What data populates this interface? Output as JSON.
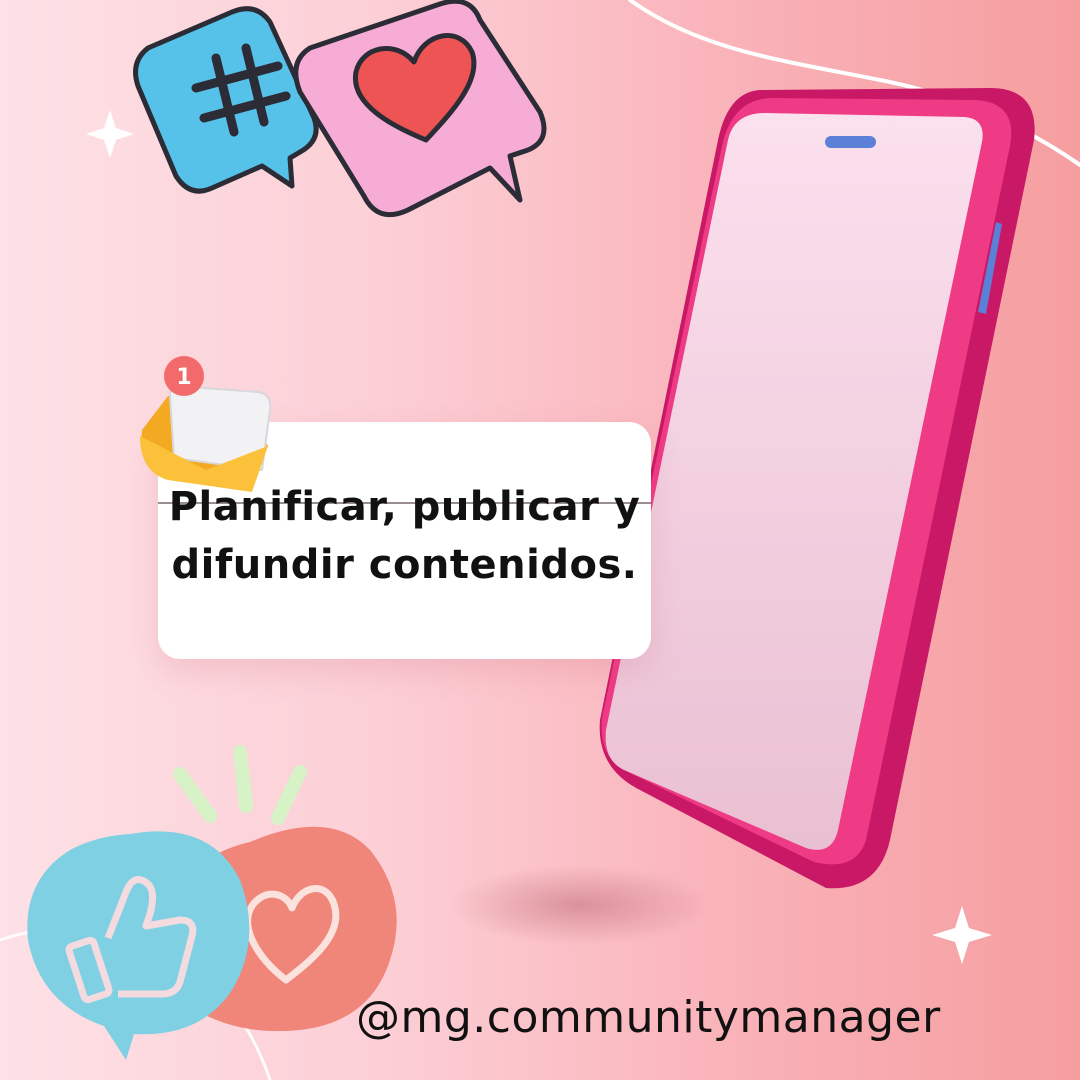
{
  "post": {
    "text_line1": "Planificar, publicar y",
    "text_line2": "difundir contenidos.",
    "handle": "@mg.communitymanager"
  },
  "notification": {
    "badge_count": "1"
  },
  "icons": {
    "hashtag": "hashtag-speech-bubble-icon",
    "heart": "heart-speech-bubble-icon",
    "envelope": "envelope-notification-icon",
    "like": "thumbs-up-bubble-icon",
    "love": "heart-outline-bubble-icon",
    "phone": "smartphone"
  },
  "colors": {
    "bg_left": "#fde1e6",
    "bg_right": "#f59e9f",
    "phone_frame": "#e9317e",
    "phone_screen": "#f7d6e3",
    "hashtag_bubble": "#56c2ea",
    "heart_bubble": "#f7acd6",
    "heart": "#ef5454",
    "like_bubble": "#7fd0e2",
    "love_bubble": "#f0857a",
    "accent_blue": "#5b80d8"
  }
}
